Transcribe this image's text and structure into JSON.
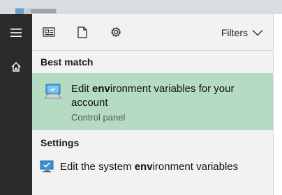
{
  "background_window": {
    "title": ""
  },
  "topbar": {
    "filters_label": "Filters"
  },
  "best_match": {
    "section_title": "Best match",
    "item": {
      "title_pre": "Edit ",
      "title_hl": "env",
      "title_post": "ironment variables for your account",
      "subtitle": "Control panel"
    }
  },
  "settings": {
    "section_title": "Settings",
    "item": {
      "label_pre": "Edit the system ",
      "label_hl": "env",
      "label_post": "ironment variables"
    }
  },
  "colors": {
    "sidebar": "#2b2b2b",
    "panel": "#f2f2f2",
    "highlight": "#b5dbc3",
    "accent": "#1f7bd6"
  },
  "icons": {
    "sidebar": [
      "hamburger-menu-icon",
      "home-icon"
    ],
    "topbar": [
      "news-feed-icon",
      "document-icon",
      "settings-gear-icon",
      "chevron-down-icon"
    ],
    "best_match": "monitor-settings-icon",
    "settings_item": "monitor-check-icon"
  }
}
